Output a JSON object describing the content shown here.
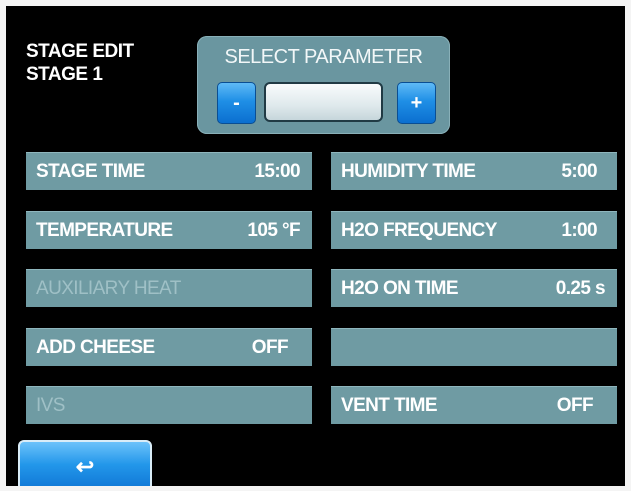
{
  "header": {
    "line1": "STAGE EDIT",
    "line2": "STAGE 1"
  },
  "select_parameter": {
    "label": "SELECT PARAMETER",
    "minus": "-",
    "plus": "+",
    "value": ""
  },
  "left": [
    {
      "label": "STAGE TIME",
      "value": "15:00",
      "enabled": true
    },
    {
      "label": "TEMPERATURE",
      "value": "105 °F",
      "enabled": true
    },
    {
      "label": "AUXILIARY HEAT",
      "value": "",
      "enabled": false
    },
    {
      "label": "ADD CHEESE",
      "value": "OFF",
      "enabled": true
    },
    {
      "label": "IVS",
      "value": "",
      "enabled": false
    }
  ],
  "right": [
    {
      "label": "HUMIDITY TIME",
      "value": "5:00",
      "enabled": true
    },
    {
      "label": "H2O FREQUENCY",
      "value": "1:00",
      "enabled": true
    },
    {
      "label": "H2O ON TIME",
      "value": "0.25 s",
      "enabled": true
    },
    {
      "label": "",
      "value": "",
      "enabled": true
    },
    {
      "label": "VENT TIME",
      "value": "OFF",
      "enabled": true
    }
  ],
  "back_button": {
    "icon": "return-arrow-icon",
    "glyph": "↩"
  },
  "colors": {
    "screen_bg": "#000000",
    "row_bg": "#6f9ba3",
    "accent_blue": "#1f8fe6",
    "disabled_text": "#9fc0c6"
  }
}
